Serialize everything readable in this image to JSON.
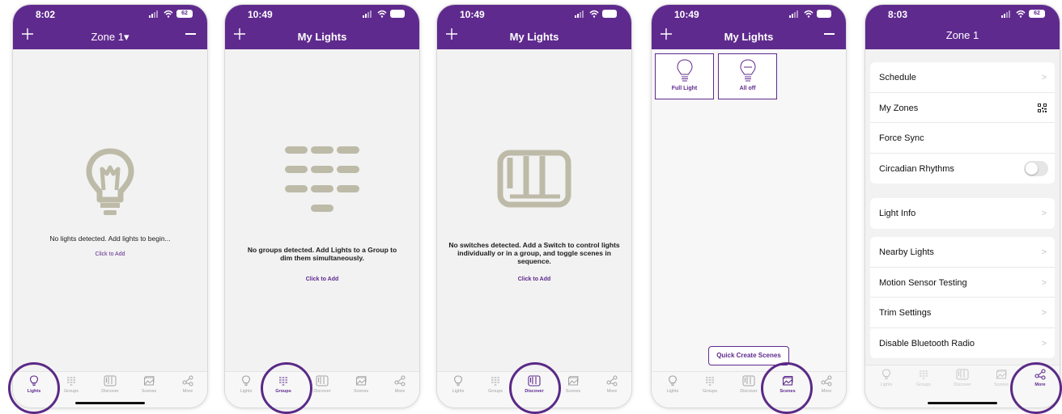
{
  "colors": {
    "brand": "#5f2a8e",
    "icon_gray": "#bdbba8",
    "inactive_tab": "#a3a3a3"
  },
  "tab_labels": {
    "lights": "Lights",
    "groups": "Groups",
    "discover": "Discover",
    "scenes": "Scenes",
    "more": "More"
  },
  "screens": [
    {
      "time": "8:02",
      "battery": "62",
      "title": "Zone 1",
      "title_caret": "▾",
      "message": "No lights detected. Add lights to begin...",
      "action": "Click to Add",
      "active_tab": "Lights"
    },
    {
      "time": "10:49",
      "title": "My Lights",
      "message": "No groups detected. Add Lights to a Group to dim them simultaneously.",
      "action": "Click to Add",
      "active_tab": "Groups"
    },
    {
      "time": "10:49",
      "title": "My Lights",
      "message": "No switches detected. Add a Switch to control lights individually or in a group, and toggle scenes in sequence.",
      "action": "Click to Add",
      "active_tab": "Discover"
    },
    {
      "time": "10:49",
      "title": "My Lights",
      "scenes": [
        "Full Light",
        "All off"
      ],
      "quick_create": "Quick Create Scenes",
      "active_tab": "Scenes"
    },
    {
      "time": "8:03",
      "battery": "62",
      "title": "Zone 1",
      "active_tab": "More",
      "groups": [
        [
          "Schedule",
          "My Zones",
          "Force Sync",
          "Circadian Rhythms"
        ],
        [
          "Light Info"
        ],
        [
          "Nearby Lights",
          "Motion Sensor Testing",
          "Trim Settings",
          "Disable Bluetooth Radio"
        ]
      ],
      "circadian_enabled": false
    }
  ]
}
